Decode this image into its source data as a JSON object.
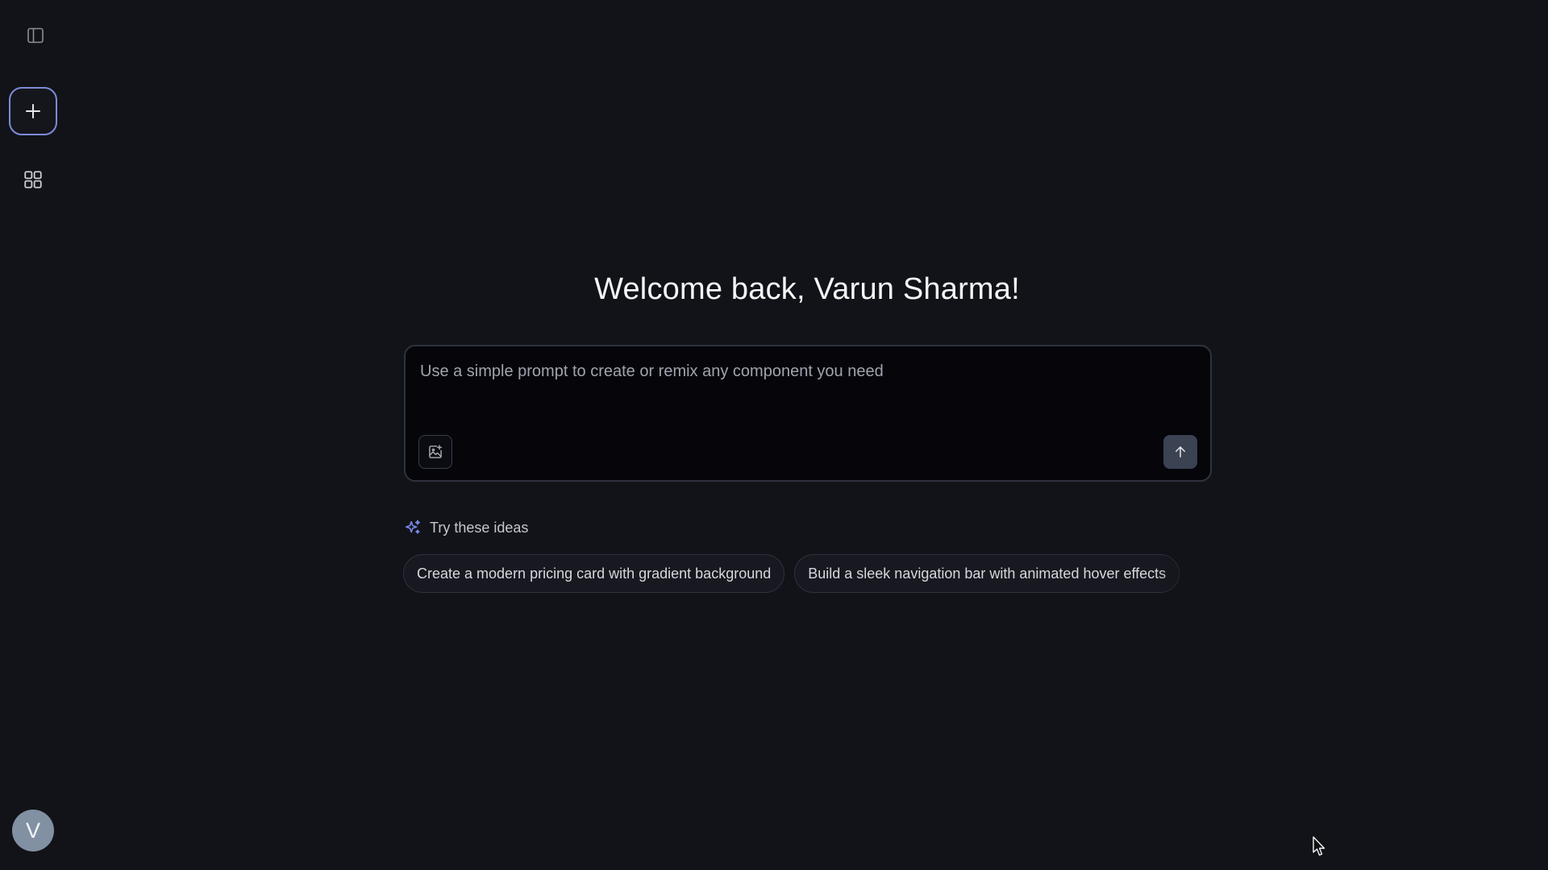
{
  "sidebar": {
    "toggle_icon": "sidebar-panel-icon",
    "new_icon": "plus-icon",
    "grid_icon": "grid-icon",
    "avatar_initial": "V",
    "accent_color": "#7b8cd6"
  },
  "main": {
    "welcome_prefix": "Welcome back,",
    "user_name": "Varun Sharma!",
    "prompt": {
      "placeholder": "Use a simple prompt to create or remix any component you need",
      "value": "",
      "image_icon": "image-plus-icon",
      "send_icon": "arrow-up-icon"
    },
    "ideas": {
      "header_label": "Try these ideas",
      "header_icon": "sparkles-icon",
      "items": [
        {
          "label": "Create a modern pricing card with gradient background"
        },
        {
          "label": "Build a sleek navigation bar with animated hover effects"
        }
      ]
    }
  }
}
